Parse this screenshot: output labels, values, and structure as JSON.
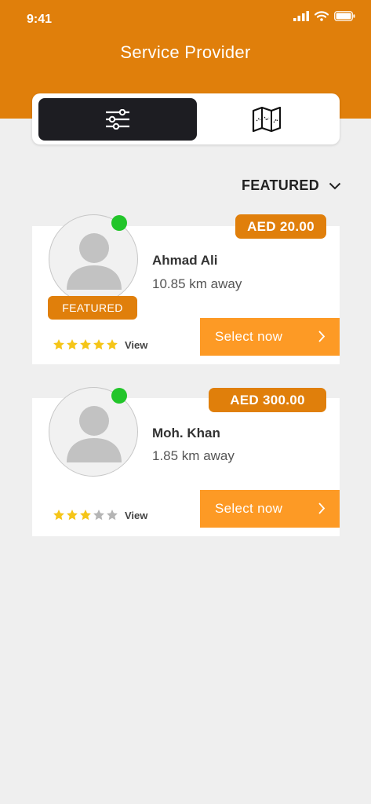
{
  "status_bar": {
    "time": "9:41"
  },
  "header": {
    "title": "Service Provider"
  },
  "view_toggle": {
    "left_icon": "sliders-icon",
    "right_icon": "map-icon"
  },
  "sort": {
    "label": "FEATURED",
    "icon": "chevron-down-icon"
  },
  "providers": [
    {
      "name": "Ahmad Ali",
      "distance": "10.85 km away",
      "price": "AED 20.00",
      "featured_label": "FEATURED",
      "rating": 5,
      "view_label": "View",
      "select_label": "Select now",
      "online": true
    },
    {
      "name": "Moh. Khan",
      "distance": "1.85 km away",
      "price": "AED 300.00",
      "rating": 3,
      "view_label": "View",
      "select_label": "Select now",
      "online": true
    }
  ],
  "colors": {
    "brand_orange": "#e07f0b",
    "button_orange": "#fd9a25",
    "online_green": "#22c52a",
    "star_filled": "#f5c518",
    "star_empty": "#b5b5b5"
  }
}
